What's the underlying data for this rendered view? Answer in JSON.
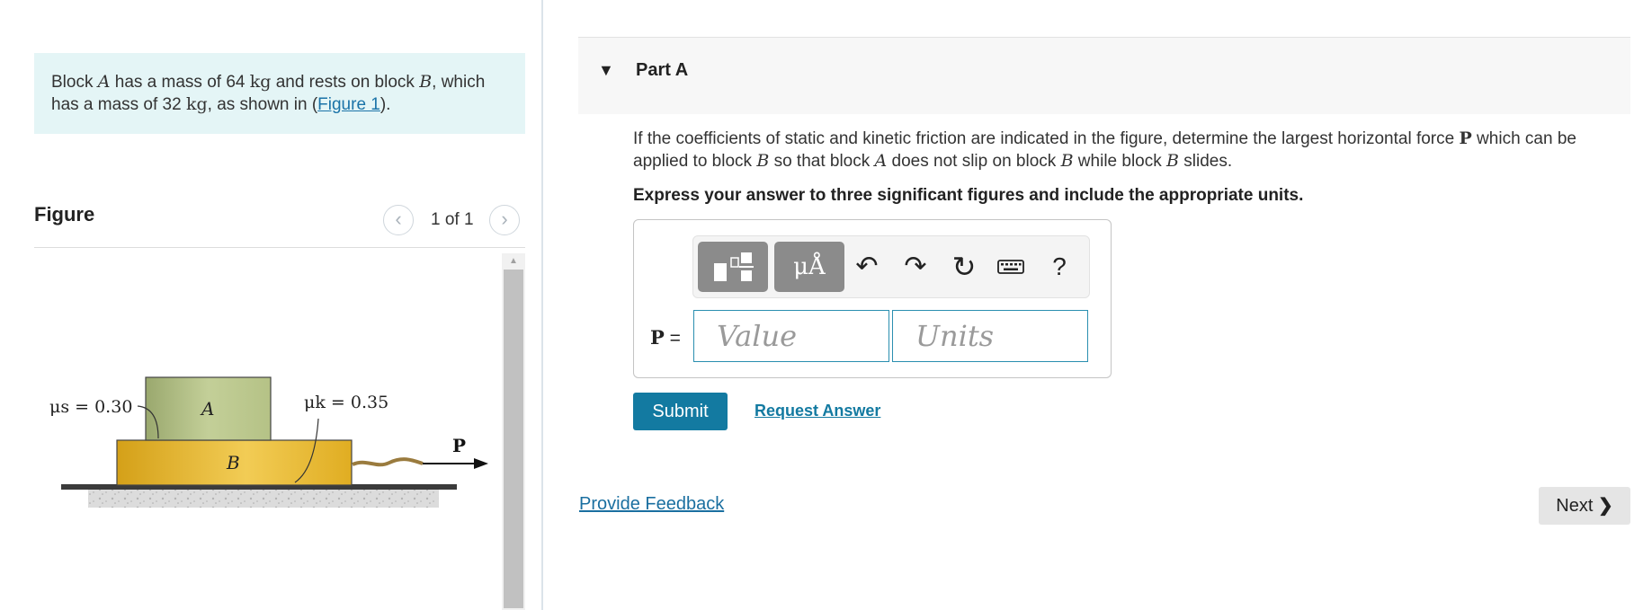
{
  "problem": {
    "text_1": "Block ",
    "var_a": "A",
    "text_2": " has a mass of 64 ",
    "unit_1": "kg",
    "text_3": " and rests on block ",
    "var_b": "B",
    "text_4": ", which has a mass of 32 ",
    "unit_2": "kg",
    "text_5": ", as shown in (",
    "figure_link": "Figure 1",
    "text_6": ")."
  },
  "figure": {
    "title": "Figure",
    "counter": "1 of 1",
    "prev_icon": "chevron-left-icon",
    "next_icon": "chevron-right-icon",
    "mu_s_label": "μs = 0.30",
    "mu_k_label": "μk = 0.35",
    "block_a_label": "A",
    "block_b_label": "B",
    "force_label": "P"
  },
  "part": {
    "caret": "▼",
    "title": "Part A"
  },
  "question": {
    "t1": "If the coefficients of static and kinetic friction are indicated in the figure, determine the largest horizontal force ",
    "P": "P",
    "t2": " which can be applied to block ",
    "B1": "B",
    "t3": " so that block ",
    "A": "A",
    "t4": " does not slip on block ",
    "B2": "B",
    "t5": " while block ",
    "B3": "B",
    "t6": " slides."
  },
  "instruction": "Express your answer to three significant figures and include the appropriate units.",
  "toolbar": {
    "units_symbol": "μÅ",
    "undo_icon": "↶",
    "redo_icon": "↷",
    "reset_icon": "↻",
    "help_label": "?"
  },
  "answer": {
    "label_var": "P",
    "label_eq": " =",
    "value_placeholder": "Value",
    "units_placeholder": "Units"
  },
  "actions": {
    "submit_label": "Submit",
    "request_answer_label": "Request Answer",
    "feedback_label": "Provide Feedback",
    "next_label": "Next"
  },
  "colors": {
    "accent": "#137aa1",
    "problem_bg": "#e4f5f6",
    "block_a": "#b7c48c",
    "block_b": "#e8b825"
  }
}
